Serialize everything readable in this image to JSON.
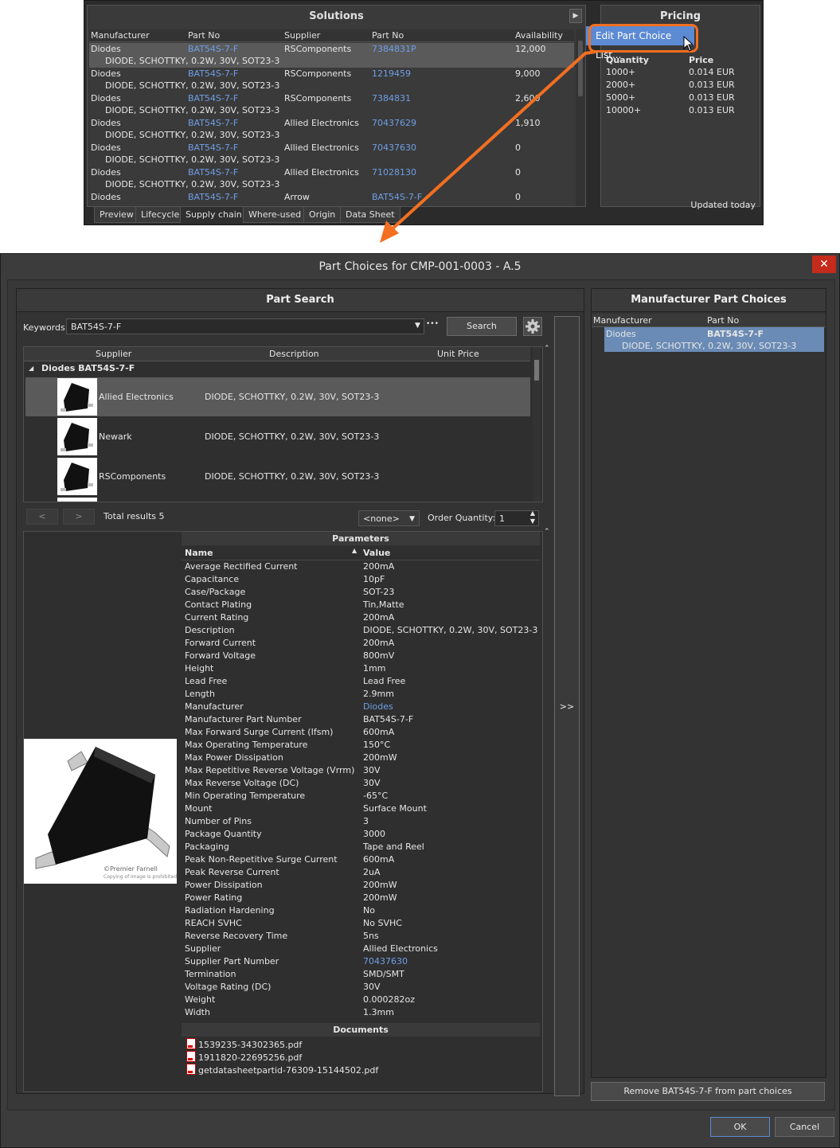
{
  "solutions": {
    "title": "Solutions",
    "headers": [
      "Manufacturer",
      "Part No",
      "Supplier",
      "Part No",
      "Availability"
    ],
    "rows": [
      {
        "manufacturer": "Diodes",
        "part_no": "BAT54S-7-F",
        "supplier": "RSComponents",
        "supplier_pn": "7384831P",
        "availability": "12,000",
        "description": "DIODE, SCHOTTKY, 0.2W, 30V, SOT23-3"
      },
      {
        "manufacturer": "Diodes",
        "part_no": "BAT54S-7-F",
        "supplier": "RSComponents",
        "supplier_pn": "1219459",
        "availability": "9,000",
        "description": "DIODE, SCHOTTKY, 0.2W, 30V, SOT23-3"
      },
      {
        "manufacturer": "Diodes",
        "part_no": "BAT54S-7-F",
        "supplier": "RSComponents",
        "supplier_pn": "7384831",
        "availability": "2,600",
        "description": "DIODE, SCHOTTKY, 0.2W, 30V, SOT23-3"
      },
      {
        "manufacturer": "Diodes",
        "part_no": "BAT54S-7-F",
        "supplier": "Allied Electronics",
        "supplier_pn": "70437629",
        "availability": "1,910",
        "description": "DIODE, SCHOTTKY, 0.2W, 30V, SOT23-3"
      },
      {
        "manufacturer": "Diodes",
        "part_no": "BAT54S-7-F",
        "supplier": "Allied Electronics",
        "supplier_pn": "70437630",
        "availability": "0",
        "description": "DIODE, SCHOTTKY, 0.2W, 30V, SOT23-3"
      },
      {
        "manufacturer": "Diodes",
        "part_no": "BAT54S-7-F",
        "supplier": "Allied Electronics",
        "supplier_pn": "71028130",
        "availability": "0",
        "description": "DIODE, SCHOTTKY, 0.2W, 30V, SOT23-3"
      },
      {
        "manufacturer": "Diodes",
        "part_no": "BAT54S-7-F",
        "supplier": "Arrow",
        "supplier_pn": "BAT54S-7-F",
        "availability": "0",
        "description": ""
      }
    ],
    "tabs": [
      "Preview",
      "Lifecycle",
      "Supply chain",
      "Where-used",
      "Origin",
      "Data Sheet"
    ],
    "active_tab": "Supply chain"
  },
  "pricing": {
    "title": "Pricing",
    "headers": [
      "Quantity",
      "Price"
    ],
    "rows": [
      {
        "qty": "1000+",
        "price": "0.014 EUR"
      },
      {
        "qty": "2000+",
        "price": "0.013 EUR"
      },
      {
        "qty": "5000+",
        "price": "0.013 EUR"
      },
      {
        "qty": "10000+",
        "price": "0.013 EUR"
      }
    ],
    "updated": "Updated today",
    "menu_item": "Edit Part Choice List..."
  },
  "dialog": {
    "title": "Part Choices for CMP-001-0003  - A.5",
    "close_glyph": "✕",
    "part_search": {
      "title": "Part Search",
      "keywords_label": "Keywords:",
      "keywords_value": "BAT54S-7-F",
      "more_glyph": "•••",
      "search_button": "Search",
      "headers": [
        "Supplier",
        "Description",
        "Unit Price"
      ],
      "group": "Diodes BAT54S-7-F",
      "results": [
        {
          "supplier": "Allied Electronics",
          "description": "DIODE, SCHOTTKY, 0.2W, 30V, SOT23-3"
        },
        {
          "supplier": "Newark",
          "description": "DIODE, SCHOTTKY, 0.2W, 30V, SOT23-3"
        },
        {
          "supplier": "RSComponents",
          "description": "DIODE, SCHOTTKY, 0.2W, 30V, SOT23-3"
        }
      ],
      "prev": "<",
      "next": ">",
      "total_results": "Total results 5",
      "currency": "<none>",
      "order_qty_label": "Order Quantity:",
      "order_qty": "1"
    },
    "parameters": {
      "title": "Parameters",
      "name_header": "Name",
      "value_header": "Value",
      "rows": [
        {
          "name": "Average Rectified Current",
          "value": "200mA"
        },
        {
          "name": "Capacitance",
          "value": "10pF"
        },
        {
          "name": "Case/Package",
          "value": "SOT-23"
        },
        {
          "name": "Contact Plating",
          "value": "Tin,Matte"
        },
        {
          "name": "Current Rating",
          "value": "200mA"
        },
        {
          "name": "Description",
          "value": "DIODE, SCHOTTKY, 0.2W, 30V, SOT23-3"
        },
        {
          "name": "Forward Current",
          "value": "200mA"
        },
        {
          "name": "Forward Voltage",
          "value": "800mV"
        },
        {
          "name": "Height",
          "value": "1mm"
        },
        {
          "name": "Lead Free",
          "value": "Lead Free"
        },
        {
          "name": "Length",
          "value": "2.9mm"
        },
        {
          "name": "Manufacturer",
          "value": "Diodes"
        },
        {
          "name": "Manufacturer Part Number",
          "value": "BAT54S-7-F"
        },
        {
          "name": "Max Forward Surge Current (Ifsm)",
          "value": "600mA"
        },
        {
          "name": "Max Operating Temperature",
          "value": "150°C"
        },
        {
          "name": "Max Power Dissipation",
          "value": "200mW"
        },
        {
          "name": "Max Repetitive Reverse Voltage (Vrrm)",
          "value": "30V"
        },
        {
          "name": "Max Reverse Voltage (DC)",
          "value": "30V"
        },
        {
          "name": "Min Operating Temperature",
          "value": "-65°C"
        },
        {
          "name": "Mount",
          "value": "Surface Mount"
        },
        {
          "name": "Number of Pins",
          "value": "3"
        },
        {
          "name": "Package Quantity",
          "value": "3000"
        },
        {
          "name": "Packaging",
          "value": "Tape and Reel"
        },
        {
          "name": "Peak Non-Repetitive Surge Current",
          "value": "600mA"
        },
        {
          "name": "Peak Reverse Current",
          "value": "2uA"
        },
        {
          "name": "Power Dissipation",
          "value": "200mW"
        },
        {
          "name": "Power Rating",
          "value": "200mW"
        },
        {
          "name": "Radiation Hardening",
          "value": "No"
        },
        {
          "name": "REACH SVHC",
          "value": "No SVHC"
        },
        {
          "name": "Reverse Recovery Time",
          "value": "5ns"
        },
        {
          "name": "Supplier",
          "value": "Allied Electronics"
        },
        {
          "name": "Supplier Part Number",
          "value": "70437630"
        },
        {
          "name": "Termination",
          "value": "SMD/SMT"
        },
        {
          "name": "Voltage Rating (DC)",
          "value": "30V"
        },
        {
          "name": "Weight",
          "value": "0.000282oz"
        },
        {
          "name": "Width",
          "value": "1.3mm"
        }
      ],
      "documents_title": "Documents",
      "documents": [
        "1539235-34302365.pdf",
        "1911820-22695256.pdf",
        "getdatasheetpartid-76309-15144502.pdf"
      ],
      "image_caption": "©Premier Farnell",
      "image_caption2": "Copying of image is prohibited"
    },
    "add_button": ">>",
    "manufacturer_choices": {
      "title": "Manufacturer Part Choices",
      "headers": [
        "Manufacturer",
        "Part No"
      ],
      "row": {
        "manufacturer": "Diodes",
        "part_no": "BAT54S-7-F",
        "description": "DIODE, SCHOTTKY, 0.2W, 30V, SOT23-3"
      },
      "remove_button": "Remove BAT54S-7-F from part choices"
    },
    "ok": "OK",
    "cancel": "Cancel"
  },
  "colors": {
    "accent": "#f36f21",
    "selection": "#5c8ad3",
    "link": "#6f9fe6",
    "close": "#c42b1c"
  }
}
